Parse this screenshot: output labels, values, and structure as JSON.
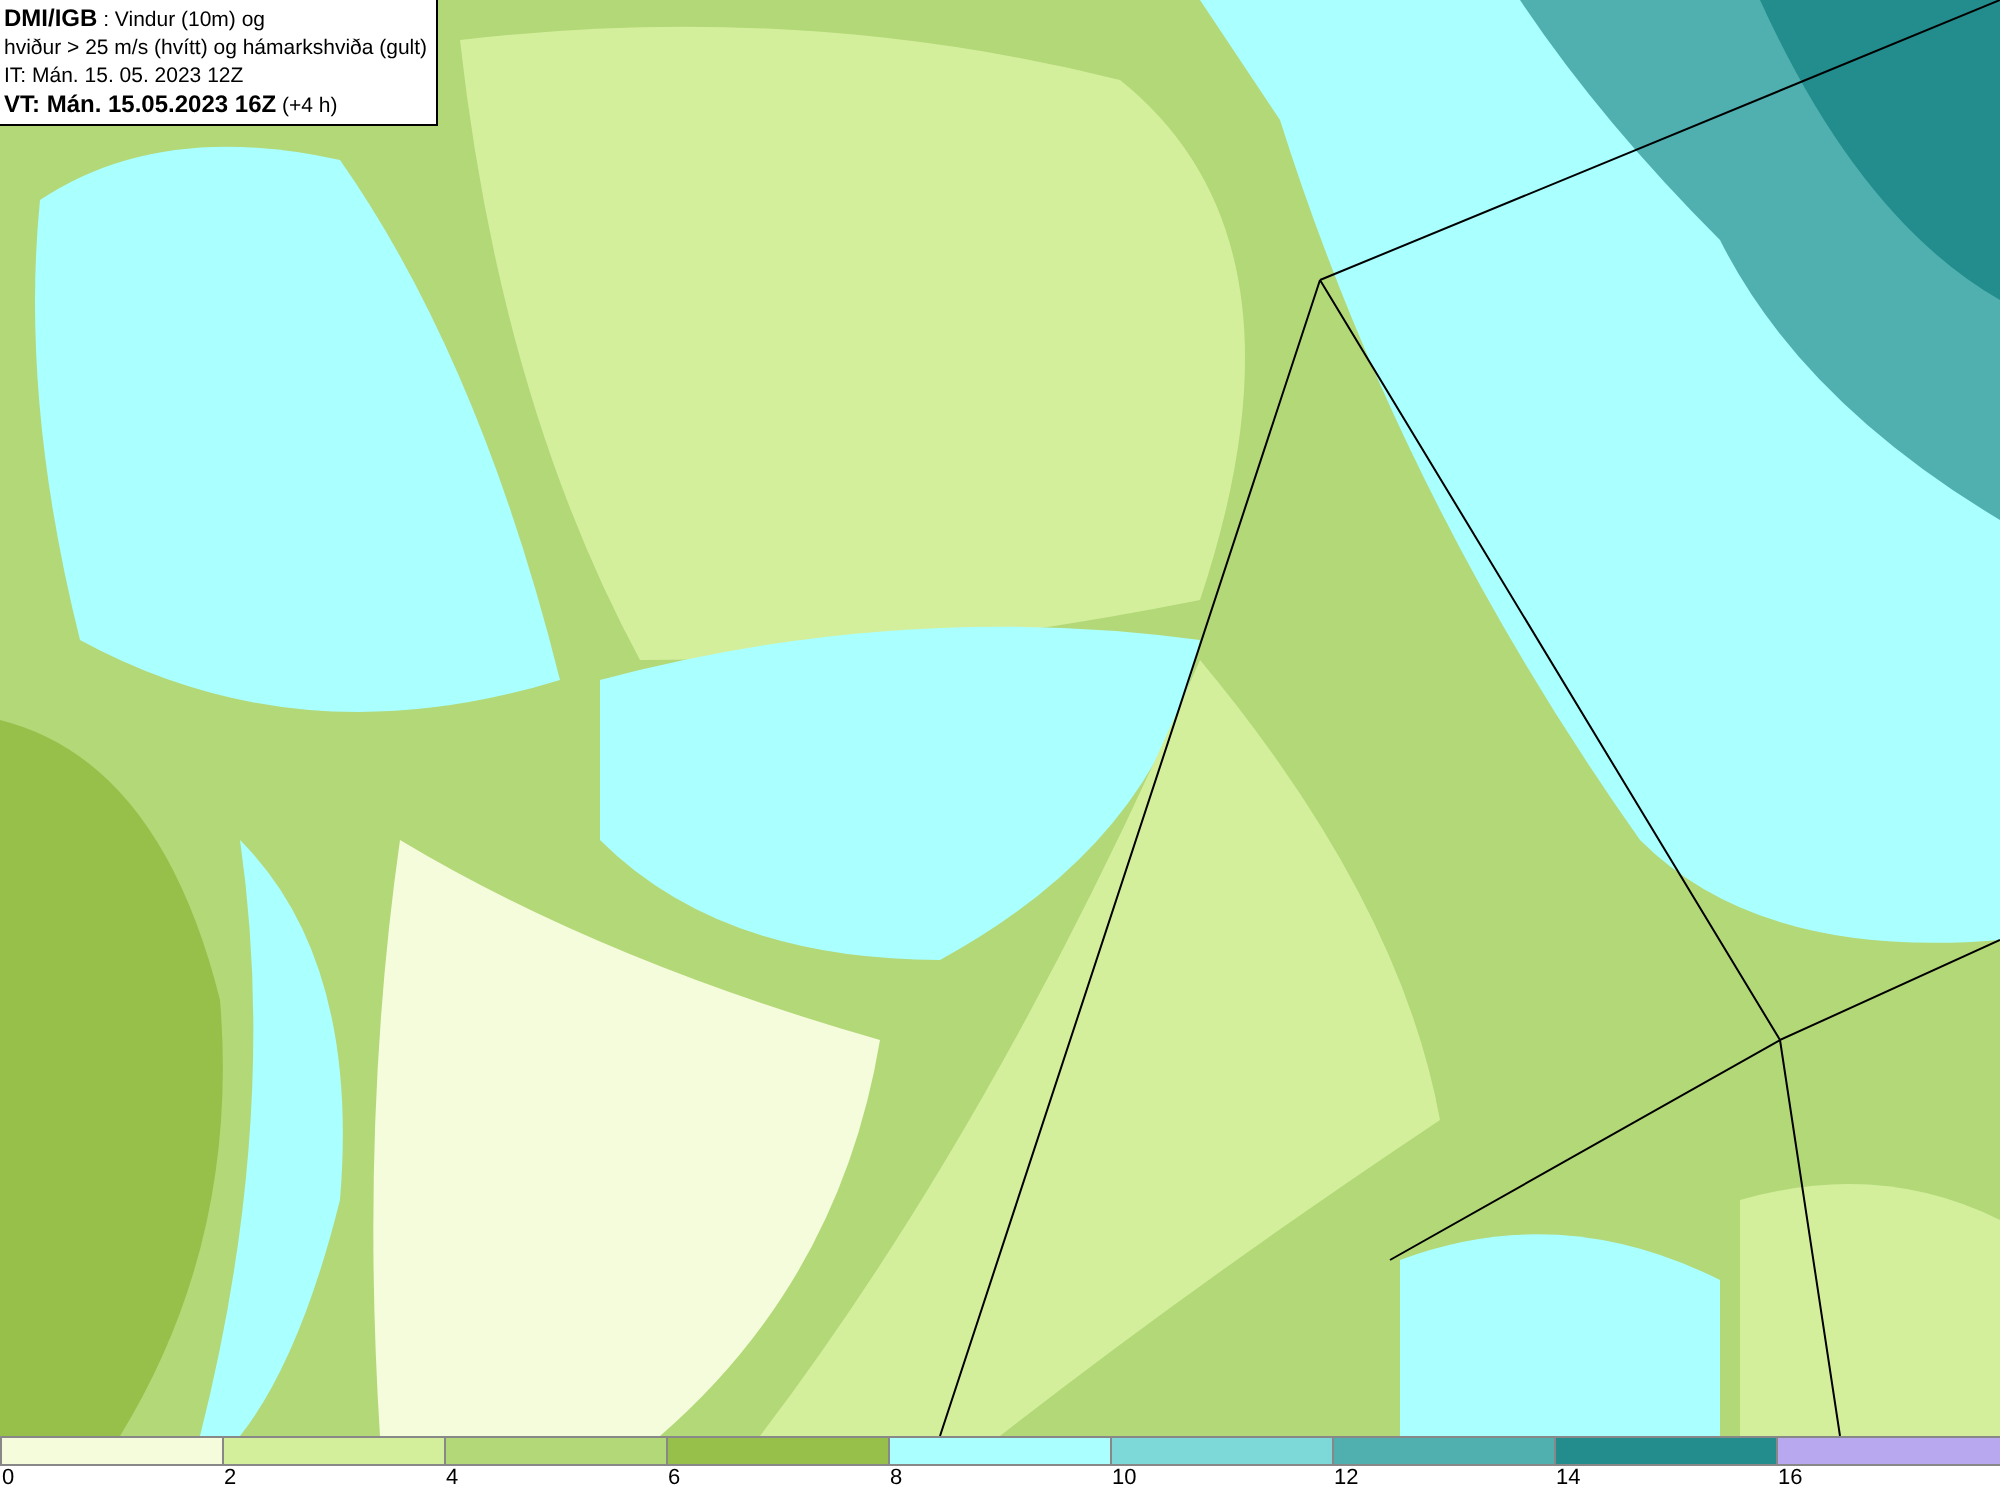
{
  "info_box": {
    "lines": [
      "**DMI/IGB** : Vindur (10m) og",
      "hviður > 25 m/s (hvítt) og hámarkshviða (gult)",
      "IT: Mán. 15. 05. 2023 12Z",
      "**VT: Mán. 15.05.2023 16Z** (+4 h)"
    ]
  },
  "legend": {
    "bins": [
      {
        "label": "0",
        "color": "#f5fcdc"
      },
      {
        "label": "2",
        "color": "#d4ef9c"
      },
      {
        "label": "4",
        "color": "#b3d878"
      },
      {
        "label": "6",
        "color": "#96c04a"
      },
      {
        "label": "8",
        "color": "#aaffff"
      },
      {
        "label": "10",
        "color": "#7dd8d8"
      },
      {
        "label": "12",
        "color": "#50b0b0"
      },
      {
        "label": "14",
        "color": "#238c8c"
      },
      {
        "label": "16",
        "color": "#b8a8f0"
      }
    ]
  }
}
